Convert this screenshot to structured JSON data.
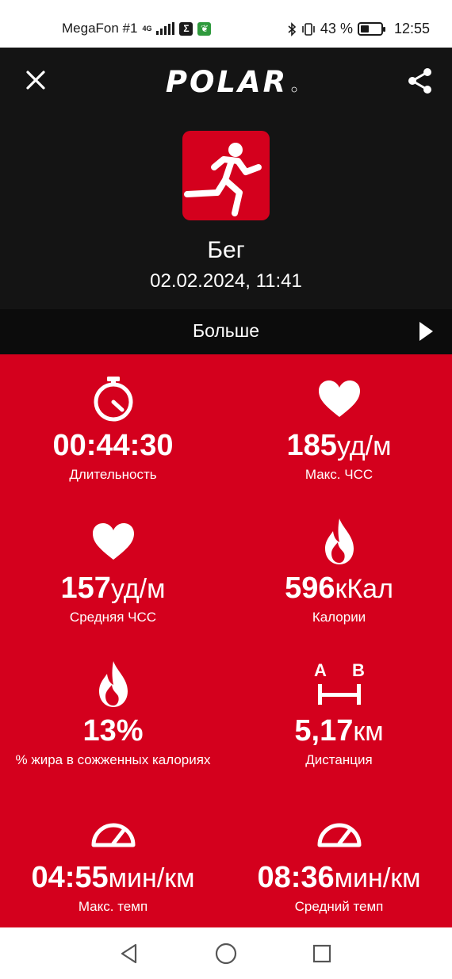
{
  "status_bar": {
    "carrier": "MegaFon #1",
    "network": "4G",
    "battery": "43 %",
    "battery_level": 0.43,
    "time": "12:55"
  },
  "app_bar": {
    "logo_text": "POLAR",
    "close_icon": "close-icon",
    "share_icon": "share-icon"
  },
  "session": {
    "sport": "Бег",
    "datetime": "02.02.2024, 11:41",
    "sport_icon": "running-icon"
  },
  "more": {
    "label": "Больше"
  },
  "stats": [
    {
      "icon": "stopwatch-icon",
      "value": "00:44:30",
      "unit": "",
      "label": "Длительность"
    },
    {
      "icon": "heart-icon",
      "value": "185",
      "unit": "уд/м",
      "label": "Макс. ЧСС"
    },
    {
      "icon": "heart-icon",
      "value": "157",
      "unit": "уд/м",
      "label": "Средняя ЧСС"
    },
    {
      "icon": "flame-icon",
      "value": "596",
      "unit": "кКал",
      "label": "Калории"
    },
    {
      "icon": "flame-icon",
      "value": "13%",
      "unit": "",
      "label": "% жира в сожженных калориях"
    },
    {
      "icon": "distance-icon",
      "value": "5,17",
      "unit": "км",
      "label": "Дистанция"
    },
    {
      "icon": "speedometer-icon",
      "value": "04:55",
      "unit": "мин/км",
      "label": "Макс. темп"
    },
    {
      "icon": "speedometer-icon",
      "value": "08:36",
      "unit": "мин/км",
      "label": "Средний темп"
    }
  ],
  "distance_icon_labels": {
    "a": "A",
    "b": "B"
  },
  "colors": {
    "accent": "#d4001d",
    "background": "#141414"
  }
}
